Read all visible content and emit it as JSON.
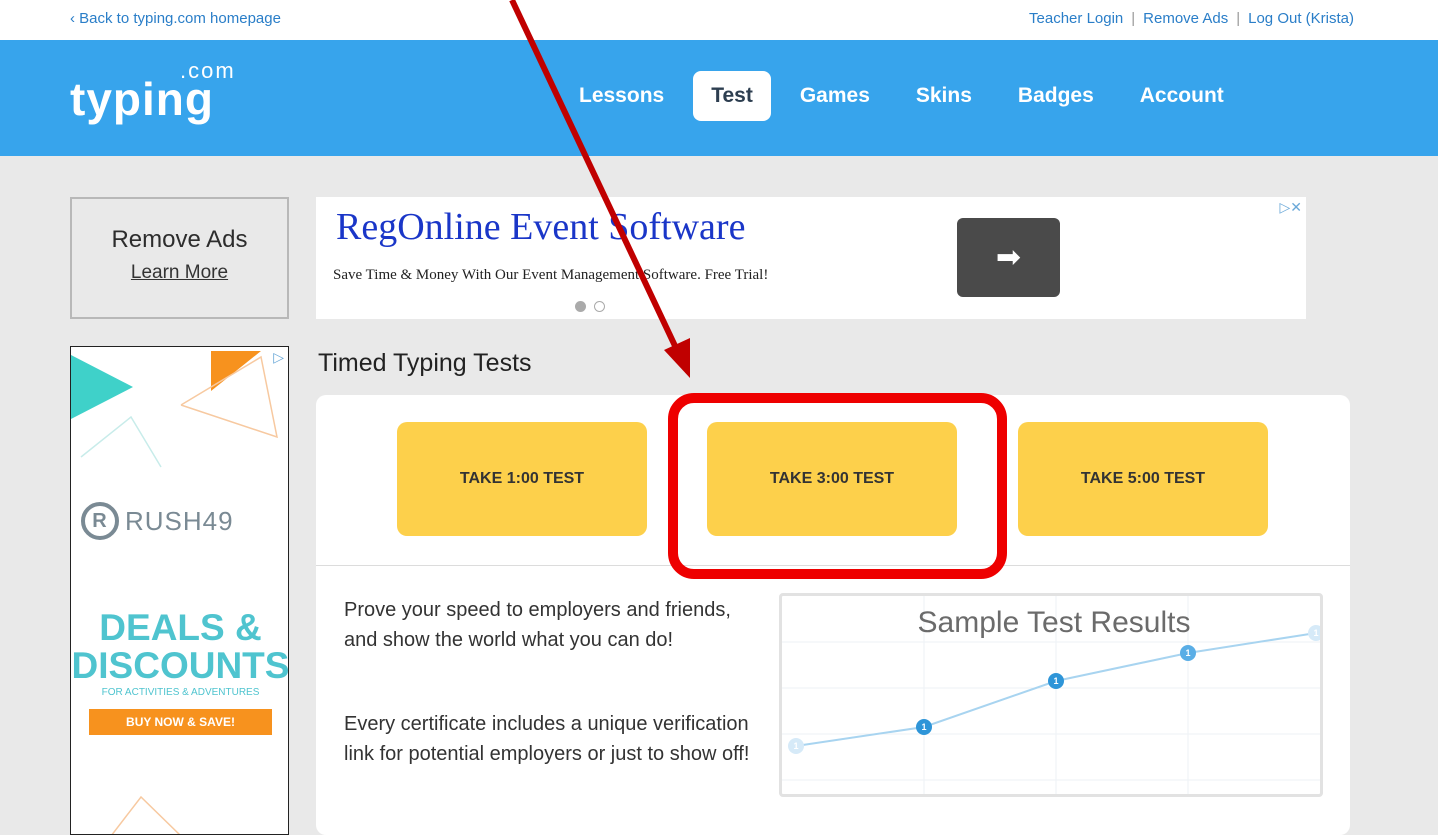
{
  "topbar": {
    "back_link": "‹ Back to typing.com homepage",
    "teacher_login": "Teacher Login",
    "remove_ads": "Remove Ads",
    "logout": "Log Out (Krista)",
    "separator": "|"
  },
  "header": {
    "logo_text": "typing",
    "logo_suffix": ".com",
    "nav": [
      {
        "label": "Lessons",
        "active": false
      },
      {
        "label": "Test",
        "active": true
      },
      {
        "label": "Games",
        "active": false
      },
      {
        "label": "Skins",
        "active": false
      },
      {
        "label": "Badges",
        "active": false
      },
      {
        "label": "Account",
        "active": false
      }
    ]
  },
  "remove_ads_box": {
    "title": "Remove Ads",
    "link": "Learn More"
  },
  "side_ad": {
    "brand": "RUSH49",
    "headline1": "DEALS &",
    "headline2": "DISCOUNTS",
    "subline": "FOR ACTIVITIES & ADVENTURES",
    "button": "BUY NOW & SAVE!"
  },
  "banner_ad": {
    "title": "RegOnline Event Software",
    "subtitle": "Save Time & Money With Our Event Management Software. Free Trial!",
    "arrow_glyph": "➡",
    "adchoice_glyph": "▷✕"
  },
  "section_title": "Timed Typing Tests",
  "tests": [
    {
      "label": "TAKE 1:00 TEST"
    },
    {
      "label": "TAKE 3:00 TEST"
    },
    {
      "label": "TAKE 5:00 TEST"
    }
  ],
  "description": {
    "para1": "Prove your speed to employers and friends, and show the world what you can do!",
    "para2": "Every certificate includes a unique verification link for potential employers or just to show off!"
  },
  "sample_chart": {
    "title": "Sample Test Results",
    "point_label": "1"
  },
  "colors": {
    "header_blue": "#37a4ec",
    "test_button_yellow": "#fdd04b",
    "highlight_red": "#ee0000",
    "arrow_red": "#c00000"
  }
}
